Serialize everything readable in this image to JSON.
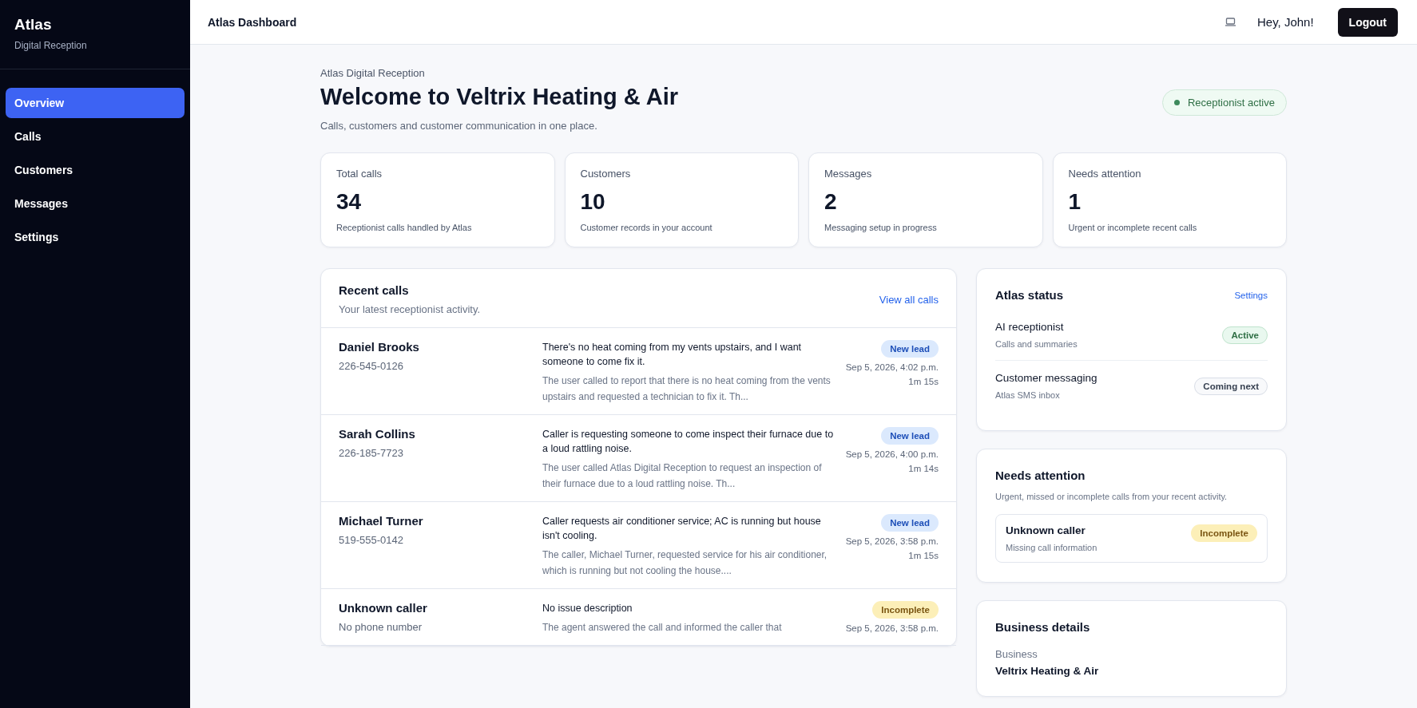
{
  "sidebar": {
    "brand": "Atlas",
    "tagline": "Digital Reception",
    "items": [
      {
        "label": "Overview",
        "selected": true
      },
      {
        "label": "Calls",
        "selected": false
      },
      {
        "label": "Customers",
        "selected": false
      },
      {
        "label": "Messages",
        "selected": false
      },
      {
        "label": "Settings",
        "selected": false
      }
    ]
  },
  "topbar": {
    "title": "Atlas Dashboard",
    "greeting": "Hey, John!",
    "logout": "Logout"
  },
  "header": {
    "eyebrow": "Atlas Digital Reception",
    "title": "Welcome to Veltrix Heating & Air",
    "subtitle": "Calls, customers and customer communication in one place.",
    "status": "Receptionist active"
  },
  "stats": [
    {
      "label": "Total calls",
      "value": "34",
      "note": "Receptionist calls handled by Atlas"
    },
    {
      "label": "Customers",
      "value": "10",
      "note": "Customer records in your account"
    },
    {
      "label": "Messages",
      "value": "2",
      "note": "Messaging setup in progress"
    },
    {
      "label": "Needs attention",
      "value": "1",
      "note": "Urgent or incomplete recent calls"
    }
  ],
  "recent_calls": {
    "title": "Recent calls",
    "subtitle": "Your latest receptionist activity.",
    "link": "View all calls",
    "rows": [
      {
        "name": "Daniel Brooks",
        "phone": "226-545-0126",
        "issue": "There's no heat coming from my vents upstairs, and I want someone to come fix it.",
        "summary": "The user called to report that there is no heat coming from the vents upstairs and requested a technician to fix it. Th...",
        "badge": "New lead",
        "kind": "lead",
        "time": "Sep 5, 2026, 4:02 p.m.",
        "duration": "1m 15s"
      },
      {
        "name": "Sarah Collins",
        "phone": "226-185-7723",
        "issue": "Caller is requesting someone to come inspect their furnace due to a loud rattling noise.",
        "summary": "The user called Atlas Digital Reception to request an inspection of their furnace due to a loud rattling noise. Th...",
        "badge": "New lead",
        "kind": "lead",
        "time": "Sep 5, 2026, 4:00 p.m.",
        "duration": "1m 14s"
      },
      {
        "name": "Michael Turner",
        "phone": "519-555-0142",
        "issue": "Caller requests air conditioner service; AC is running but house isn't cooling.",
        "summary": "The caller, Michael Turner, requested service for his air conditioner, which is running but not cooling the house....",
        "badge": "New lead",
        "kind": "lead",
        "time": "Sep 5, 2026, 3:58 p.m.",
        "duration": "1m 15s"
      },
      {
        "name": "Unknown caller",
        "phone": "No phone number",
        "issue": "No issue description",
        "summary": "The agent answered the call and informed the caller that",
        "badge": "Incomplete",
        "kind": "incomplete",
        "time": "Sep 5, 2026, 3:58 p.m."
      }
    ]
  },
  "atlas_status": {
    "title": "Atlas status",
    "link": "Settings",
    "items": [
      {
        "name": "AI receptionist",
        "detail": "Calls and summaries",
        "badge": "Active",
        "kind": "active"
      },
      {
        "name": "Customer messaging",
        "detail": "Atlas SMS inbox",
        "badge": "Coming next",
        "kind": "pending"
      }
    ]
  },
  "needs_attention": {
    "title": "Needs attention",
    "subtitle": "Urgent, missed or incomplete calls from your recent activity.",
    "items": [
      {
        "name": "Unknown caller",
        "detail": "Missing call information",
        "badge": "Incomplete",
        "kind": "incomplete"
      }
    ]
  },
  "business_details": {
    "title": "Business details",
    "label": "Business",
    "value": "Veltrix Heating & Air"
  }
}
